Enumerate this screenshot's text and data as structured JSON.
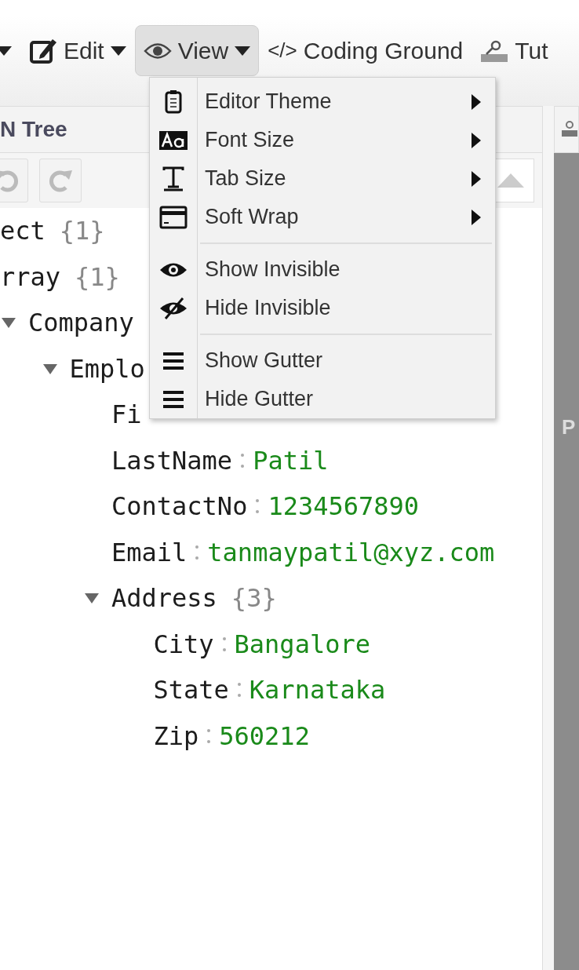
{
  "toolbar": {
    "items": [
      {
        "kind": "caret"
      },
      {
        "kind": "menu",
        "label": "Edit",
        "selected": false
      },
      {
        "kind": "menu",
        "label": "View",
        "selected": true
      },
      {
        "kind": "link",
        "prefix": "</>",
        "label": "Coding Ground"
      },
      {
        "kind": "link",
        "label": "Tut"
      }
    ]
  },
  "left_panel": {
    "title": "N Tree"
  },
  "tree": [
    {
      "key": "ect",
      "count": "{1}",
      "children": [
        {
          "key": "rray",
          "count": "{1}",
          "children": [
            {
              "key": "Company",
              "expanded": true,
              "children": [
                {
                  "key": "Emplo",
                  "expanded": true,
                  "children": [
                    {
                      "key": "Fi"
                    },
                    {
                      "key": "LastName",
                      "value": "Patil"
                    },
                    {
                      "key": "ContactNo",
                      "value": "1234567890"
                    },
                    {
                      "key": "Email",
                      "value": "tanmaypatil@xyz.com"
                    },
                    {
                      "key": "Address",
                      "count": "{3}",
                      "expanded": true,
                      "children": [
                        {
                          "key": "City",
                          "value": "Bangalore"
                        },
                        {
                          "key": "State",
                          "value": "Karnataka"
                        },
                        {
                          "key": "Zip",
                          "value": "560212"
                        }
                      ]
                    }
                  ]
                }
              ]
            }
          ]
        }
      ]
    }
  ],
  "right_panel": {
    "label": "P"
  },
  "view_menu": {
    "groups": [
      [
        {
          "label": "Editor Theme",
          "submenu": true
        },
        {
          "label": "Font Size",
          "submenu": true
        },
        {
          "label": "Tab Size",
          "submenu": true
        },
        {
          "label": "Soft Wrap",
          "submenu": true
        }
      ],
      [
        {
          "label": "Show Invisible",
          "submenu": false
        },
        {
          "label": "Hide Invisible",
          "submenu": false
        }
      ],
      [
        {
          "label": "Show Gutter",
          "submenu": false
        },
        {
          "label": "Hide Gutter",
          "submenu": false
        }
      ]
    ]
  }
}
